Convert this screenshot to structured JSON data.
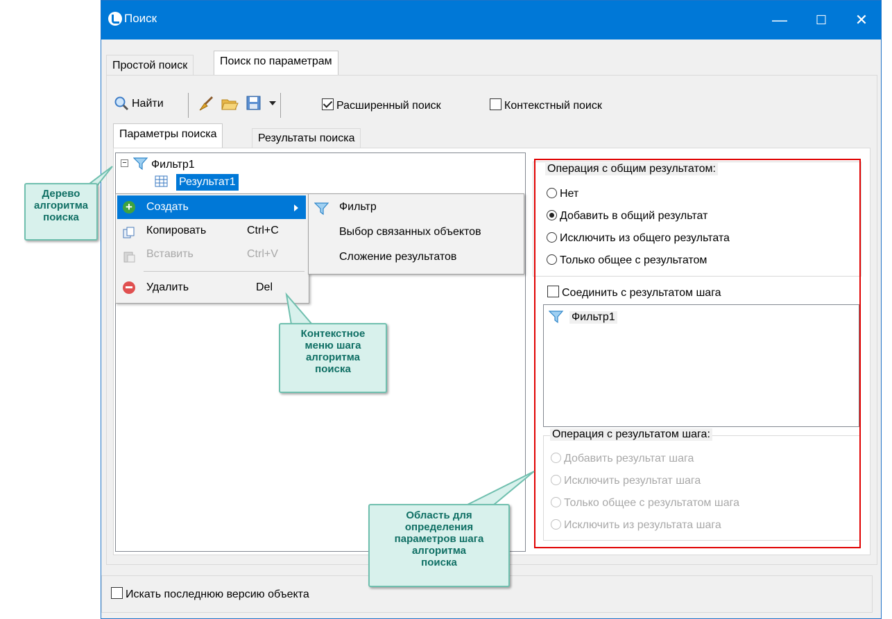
{
  "window": {
    "title": "Поиск",
    "controls": [
      "—",
      "☐",
      "✕"
    ]
  },
  "top_tabs": [
    "Простой поиск",
    "Поиск по параметрам"
  ],
  "toolbar": {
    "find_label": "Найти",
    "extended_search": {
      "label": "Расширенный поиск",
      "checked": true
    },
    "context_search": {
      "label": "Контекстный поиск",
      "checked": false
    }
  },
  "sub_tabs": [
    "Параметры поиска",
    "Результаты поиска"
  ],
  "tree": {
    "root": "Фильтр1",
    "child": "Результат1"
  },
  "context_menu": {
    "items": [
      {
        "label": "Создать",
        "shortcut": "",
        "icon": "plus-circle-icon",
        "enabled": true
      },
      {
        "label": "Копировать",
        "shortcut": "Ctrl+C",
        "icon": "copy-icon",
        "enabled": true
      },
      {
        "label": "Вставить",
        "shortcut": "Ctrl+V",
        "icon": "paste-icon",
        "enabled": false
      },
      {
        "label": "Удалить",
        "shortcut": "Del",
        "icon": "minus-circle-icon",
        "enabled": true
      }
    ],
    "submenu": [
      "Фильтр",
      "Выбор связанных объектов",
      "Сложение результатов"
    ]
  },
  "right_panel": {
    "common_group_title": "Операция с общим результатом:",
    "common_options": [
      "Нет",
      "Добавить в общий результат",
      "Исключить из общего результата",
      "Только общее с результатом"
    ],
    "common_selected": 1,
    "join_label": "Соединить с результатом шага",
    "join_checked": false,
    "step_list": [
      "Фильтр1"
    ],
    "step_group_title": "Операция с результатом шага:",
    "step_options": [
      "Добавить результат шага",
      "Исключить результат шага",
      "Только общее с результатом шага",
      "Исключить из результата шага"
    ]
  },
  "footer": {
    "last_version_label": "Искать последнюю версию объекта",
    "checked": false
  },
  "callouts": {
    "tree": [
      "Дерево",
      "алгоритма",
      "поиска"
    ],
    "menu": [
      "Контекстное",
      "меню шага",
      "алгоритма",
      "поиска"
    ],
    "params": [
      "Область для",
      "определения",
      "параметров шага",
      "алгоритма",
      "поиска"
    ]
  },
  "colors": {
    "titlebar": "#0078d7",
    "highlight": "#0078d7",
    "callout_bg": "#d8f1ec",
    "callout_text": "#0f6f64",
    "red_frame": "#e00000"
  }
}
